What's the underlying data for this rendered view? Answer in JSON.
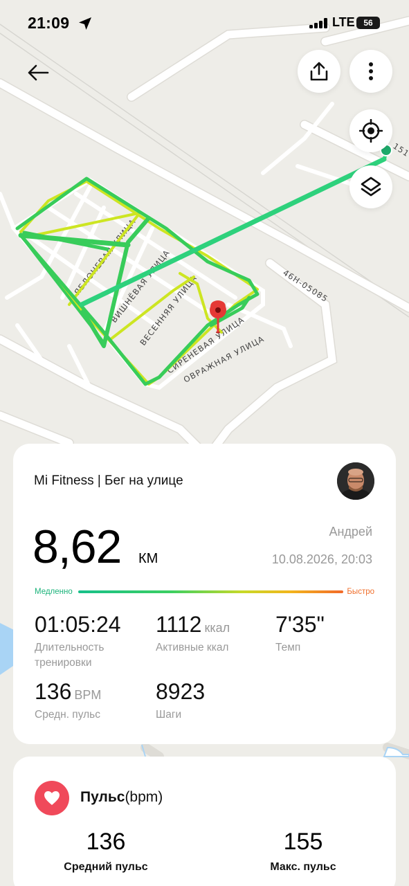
{
  "status_bar": {
    "time": "21:09",
    "network": "LTE",
    "battery": "56"
  },
  "map": {
    "street_labels": [
      "ЯБЛОНЕВАЯ УЛИЦА",
      "ВИШНЁВАЯ УЛИЦА",
      "ВЕСЕННЯЯ УЛИЦА",
      "СИРЕНЕВАЯ УЛИЦА",
      "ОВРАЖНАЯ УЛИЦА",
      "46Н-05085",
      "151"
    ],
    "colors": {
      "background": "#eeede8",
      "road": "#ffffff",
      "track_fast": "#2ecc71",
      "track_slow": "#d4e619",
      "end_pin": "#e53935",
      "start_marker": "#1eaa6b"
    }
  },
  "top_buttons": {
    "back_icon": "arrow-left-icon",
    "share_icon": "share-icon",
    "more_icon": "more-vertical-icon",
    "locate_icon": "crosshair-icon",
    "layers_icon": "layers-icon"
  },
  "summary": {
    "app_label": "Mi Fitness | Бег на улице",
    "distance": "8,62",
    "distance_unit": "КМ",
    "user_name": "Андрей",
    "date": "10.08.2026, 20:03",
    "pace_slow_label": "Медленно",
    "pace_fast_label": "Быстро",
    "metrics": {
      "duration": {
        "value": "01:05:24",
        "label": "Длительность тренировки"
      },
      "calories": {
        "value": "1112",
        "unit": "ккал",
        "label": "Активные ккал"
      },
      "pace": {
        "value": "7'35\"",
        "label": "Темп"
      },
      "avg_hr": {
        "value": "136",
        "unit": "BPM",
        "label": "Средн. пульс"
      },
      "steps": {
        "value": "8923",
        "label": "Шаги"
      }
    }
  },
  "heart_rate": {
    "title_bold": "Пульс",
    "title_unit": "(bpm)",
    "icon": "heart-icon",
    "accent": "#f0495a",
    "avg_value": "136",
    "avg_label": "Средний пульс",
    "max_value": "155",
    "max_label": "Макс. пульс"
  }
}
